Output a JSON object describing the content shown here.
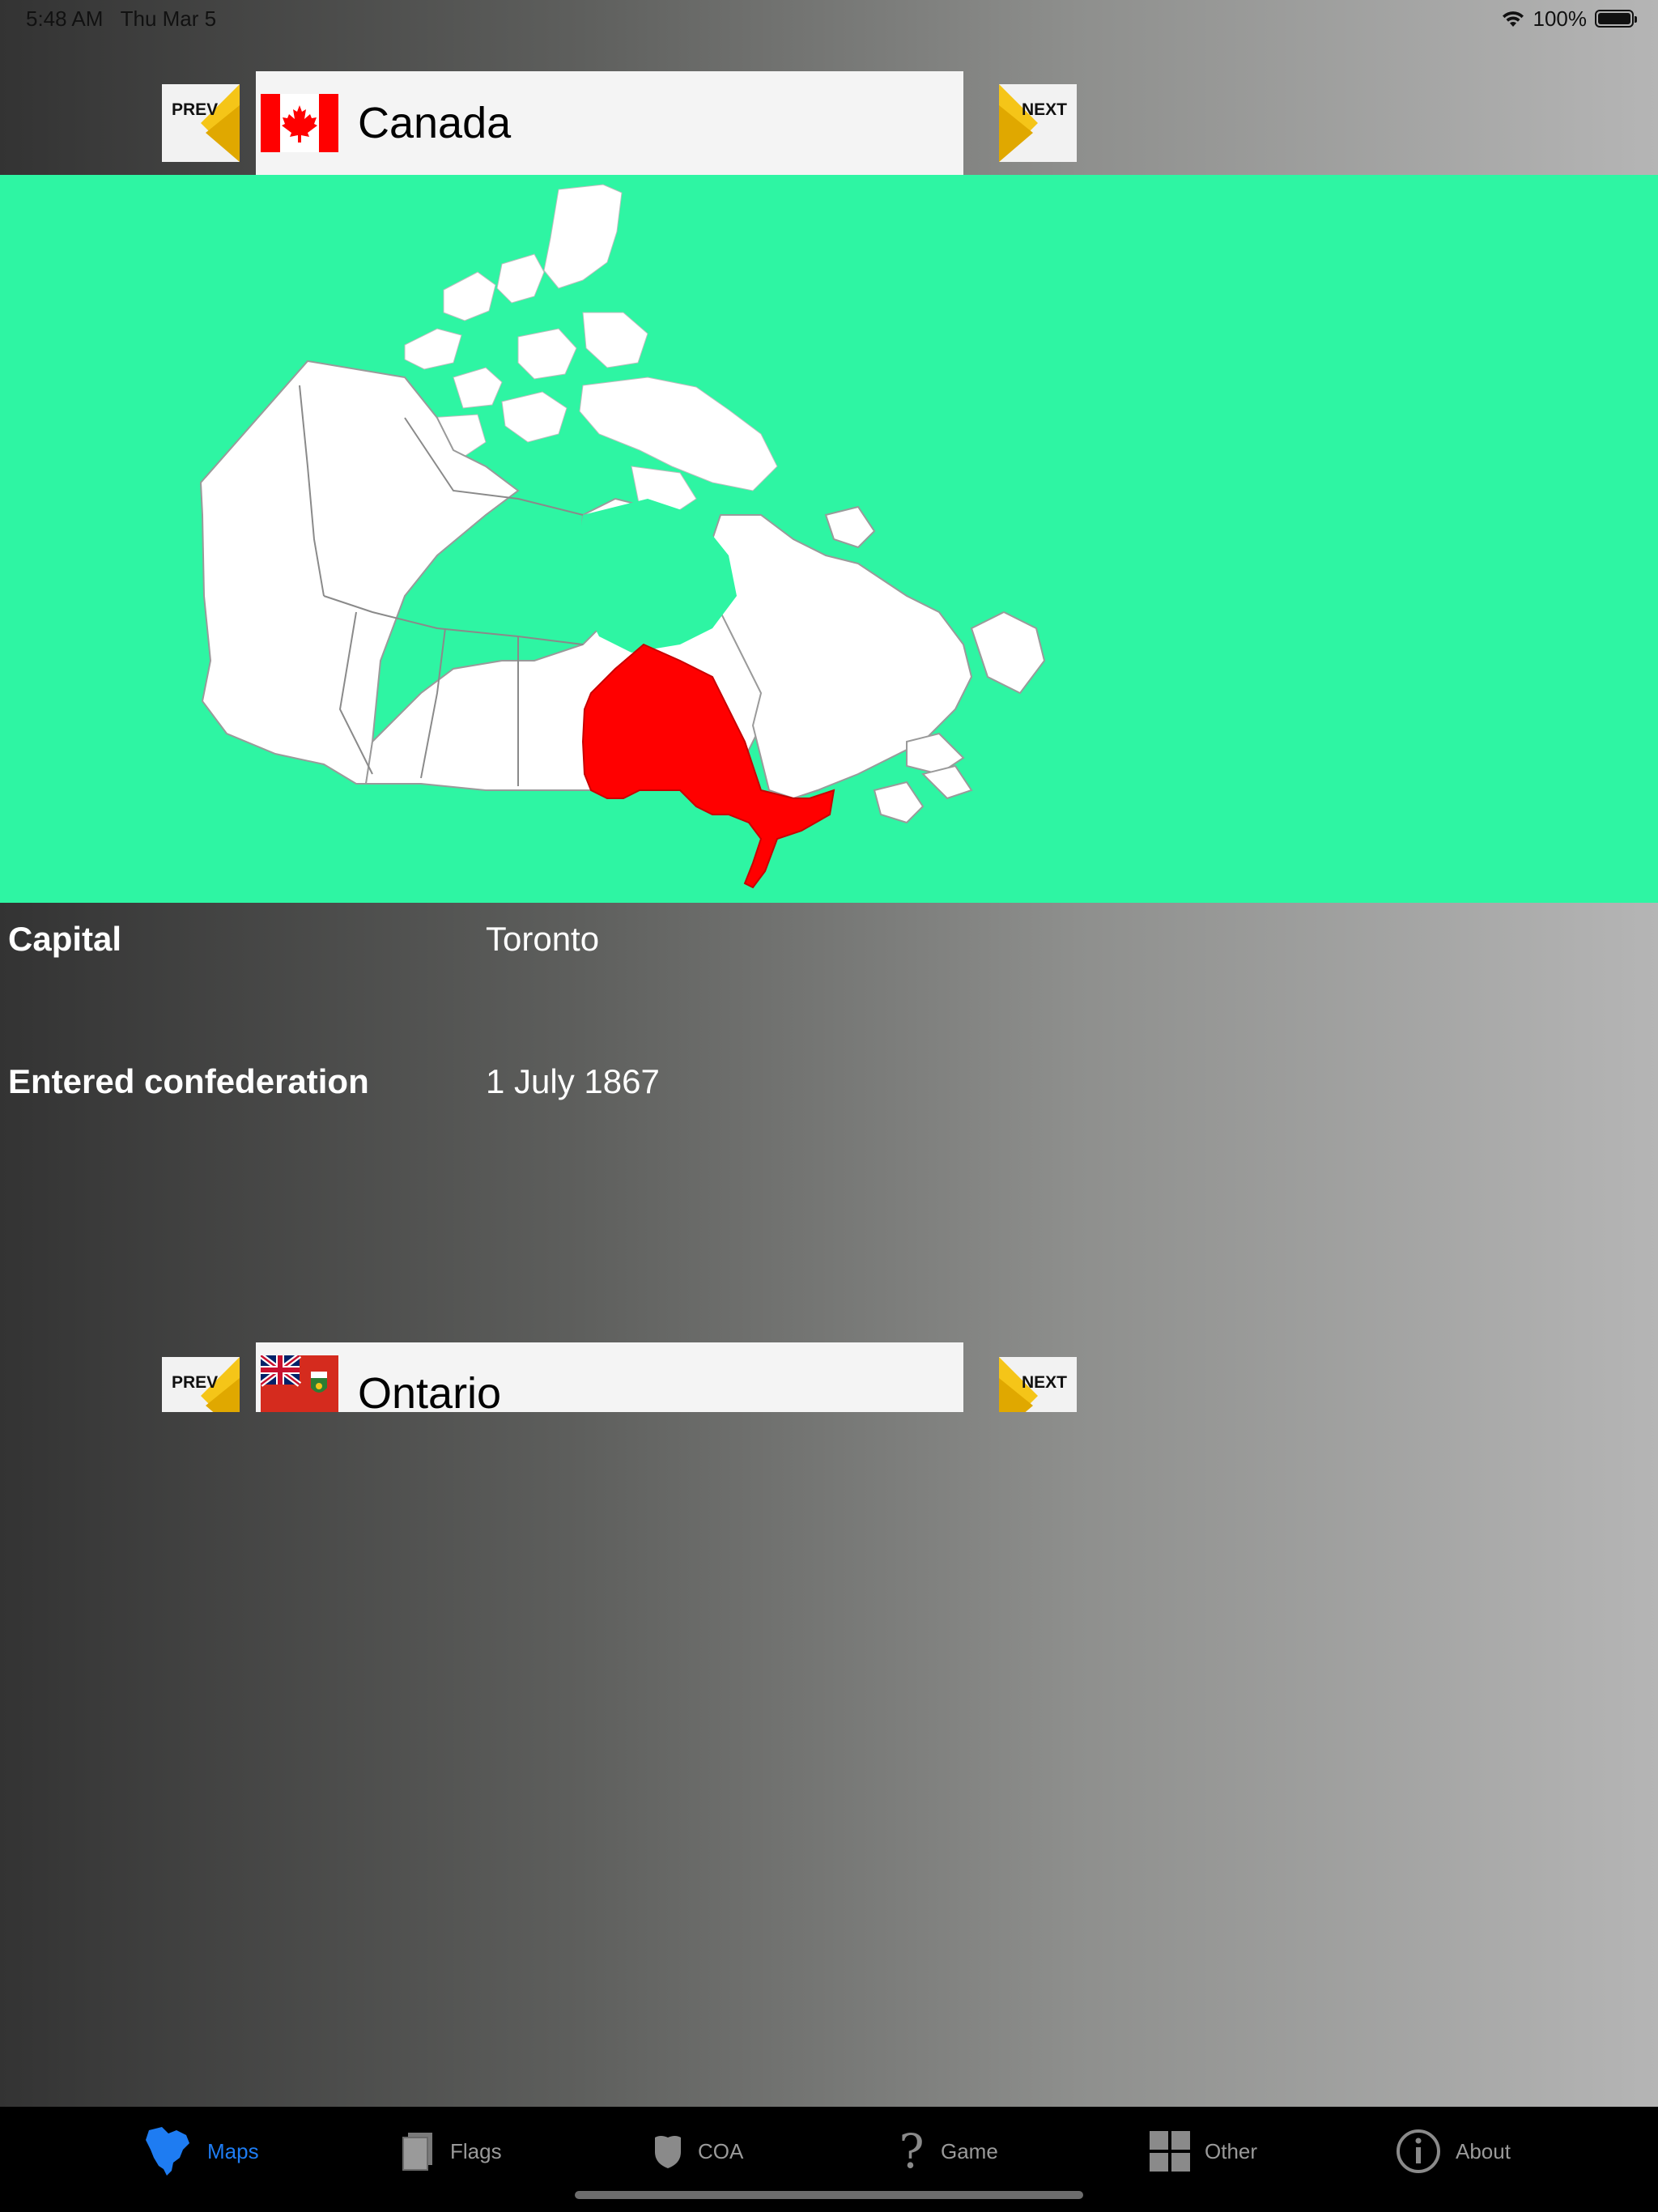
{
  "status": {
    "time": "5:48 AM",
    "date": "Thu Mar 5",
    "battery": "100%"
  },
  "country_nav": {
    "prev_label": "PREV",
    "next_label": "NEXT",
    "title": "Canada",
    "flag_icon": "canada-flag"
  },
  "map": {
    "background": "#2ef5a3",
    "highlight_color": "#ff0000",
    "highlighted_region": "Ontario"
  },
  "info": [
    {
      "label": "Capital",
      "value": "Toronto"
    },
    {
      "label": "Entered confederation",
      "value": "1 July 1867"
    }
  ],
  "region_nav": {
    "prev_label": "PREV",
    "next_label": "NEXT",
    "title": "Ontario",
    "flag_icon": "ontario-flag"
  },
  "tabs": [
    {
      "label": "Maps",
      "icon": "north-america-icon",
      "active": true
    },
    {
      "label": "Flags",
      "icon": "flag-book-icon",
      "active": false
    },
    {
      "label": "COA",
      "icon": "shield-icon",
      "active": false
    },
    {
      "label": "Game",
      "icon": "question-icon",
      "active": false
    },
    {
      "label": "Other",
      "icon": "grid-icon",
      "active": false
    },
    {
      "label": "About",
      "icon": "info-icon",
      "active": false
    }
  ],
  "colors": {
    "accent": "#1e7cf2",
    "arrow_yellow": "#f5c518"
  }
}
